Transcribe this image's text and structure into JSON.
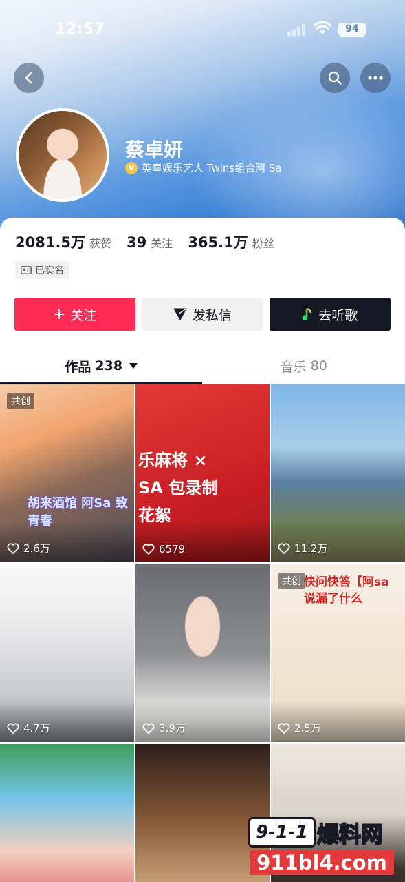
{
  "status_bar": {
    "time": "12:57",
    "battery": "94"
  },
  "profile": {
    "name": "蔡卓妍",
    "verified_badge": "V",
    "verified_text": "英皇娱乐艺人 Twins组合阿 Sa"
  },
  "stats": [
    {
      "value": "2081.5万",
      "label": "获赞"
    },
    {
      "value": "39",
      "label": "关注"
    },
    {
      "value": "365.1万",
      "label": "粉丝"
    }
  ],
  "realname_label": "已实名",
  "actions": {
    "follow": "关注",
    "message": "发私信",
    "music": "去听歌"
  },
  "tabs": [
    {
      "label": "作品",
      "count": "238"
    },
    {
      "label": "音乐",
      "count": "80"
    }
  ],
  "videos": [
    {
      "likes": "2.6万",
      "badge": "共创",
      "overlay": "胡来酒馆 阿Sa 致青春"
    },
    {
      "likes": "6579",
      "overlay": "乐麻将 × SA 包录制花絮"
    },
    {
      "likes": "11.2万"
    },
    {
      "likes": "4.7万"
    },
    {
      "likes": "3.9万"
    },
    {
      "likes": "2.5万",
      "badge": "共创",
      "overlay": "快问快答【阿sa 说漏了什么"
    },
    {
      "likes": ""
    },
    {
      "likes": ""
    },
    {
      "likes": ""
    }
  ],
  "watermark": {
    "logo": "9-1-1",
    "title": "爆料网",
    "url": "911bl4.com"
  },
  "colors": {
    "accent": "#fe2c55",
    "dark": "#161823",
    "secondary": "#f1f1f2"
  },
  "icons": [
    "back-icon",
    "search-icon",
    "more-icon",
    "verified-icon",
    "id-card-icon",
    "plus-icon",
    "send-icon",
    "music-note-icon",
    "heart-icon",
    "caret-down-icon"
  ]
}
